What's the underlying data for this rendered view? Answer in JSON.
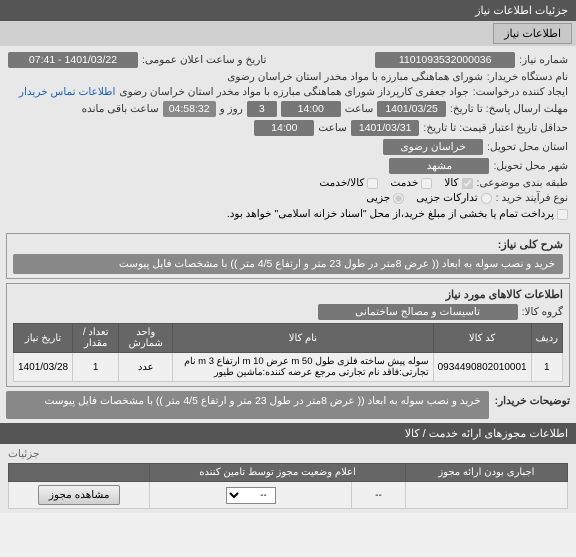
{
  "header": {
    "title": "جزئیات اطلاعات نیاز"
  },
  "tabs": {
    "info": "اطلاعات نیاز"
  },
  "form": {
    "need_no_label": "شماره نیاز:",
    "need_no": "1101093532000036",
    "announce_label": "تاریخ و ساعت اعلان عمومی:",
    "announce": "1401/03/22 - 07:41",
    "buyer_label": "نام دستگاه خریدار:",
    "buyer": "شورای هماهنگی مبارزه با مواد مخدر استان خراسان رضوی",
    "creator_label": "ایجاد کننده درخواست:",
    "creator": "جواد جعفری کارپرداز شورای هماهنگی مبارزه با مواد مخدر استان خراسان رضوی",
    "contact_link": "اطلاعات تماس خریدار",
    "deadline_label": "مهلت ارسال پاسخ: تا تاریخ:",
    "deadline_date": "1401/03/25",
    "time_label": "ساعت",
    "deadline_time": "14:00",
    "days": "3",
    "days_label": "روز و",
    "countdown": "04:58:32",
    "remain_label": "ساعت باقی مانده",
    "min_valid_label": "حداقل تاریخ اعتبار قیمت: تا تاریخ:",
    "min_valid_date": "1401/03/31",
    "min_valid_time": "14:00",
    "province_label": "استان محل تحویل:",
    "province": "خراسان رضوی",
    "city_label": "شهر محل تحویل:",
    "city": "مشهد",
    "topic_label": "طبقه بندی موضوعی:",
    "chk_kala": "کالا",
    "chk_service": "خدمت",
    "chk_both": "کالا/خدمت",
    "process_label": "نوع فرآیند خرید :",
    "process_opt1": "تدارکات جزیی",
    "process_opt2": "جزیی",
    "process_note": "پرداخت تمام یا بخشی از مبلغ خرید،از محل \"اسناد خزانه اسلامی\" خواهد بود."
  },
  "desc": {
    "title": "شرح کلی نیاز:",
    "text": "خرید و نصب سوله به ابعاد (( عرض 8متر در طول 23 متر و ارتفاع 4/5 متر )) با مشخصات فایل پیوست"
  },
  "items": {
    "title": "اطلاعات کالاهای مورد نیاز",
    "group_label": "گروه کالا:",
    "group": "تاسیسات و مصالح ساختمانی",
    "cols": {
      "row": "ردیف",
      "code": "کد کالا",
      "name": "نام کالا",
      "unit": "واحد شمارش",
      "qty": "تعداد / مقدار",
      "date": "تاریخ نیاز"
    },
    "rows": [
      {
        "row": "1",
        "code": "0934490802010001",
        "name": "سوله پیش ساخته فلزی طول m 50 عرض m 10 ارتفاع m 3  نام تجارتی:فاقد نام تجارتی مرجع عرضه کننده:ماشین طیور",
        "unit": "عدد",
        "qty": "1",
        "date": "1401/03/28"
      }
    ]
  },
  "buyer_note": {
    "label": "توضیحات خریدار:",
    "text": "خرید و نصب سوله به ابعاد (( عرض 8متر در طول 23 متر و ارتفاع 4/5 متر )) با مشخصات فایل پیوست"
  },
  "permits": {
    "header": "اطلاعات مجوزهای ارائه خدمت / کالا",
    "required_label": "اجباری بودن ارائه مجوز",
    "status_title": "اعلام وضعیت مجوز توسط تامین کننده",
    "view_btn": "مشاهده مجوز",
    "dash": "--",
    "details": "جزئیات"
  }
}
